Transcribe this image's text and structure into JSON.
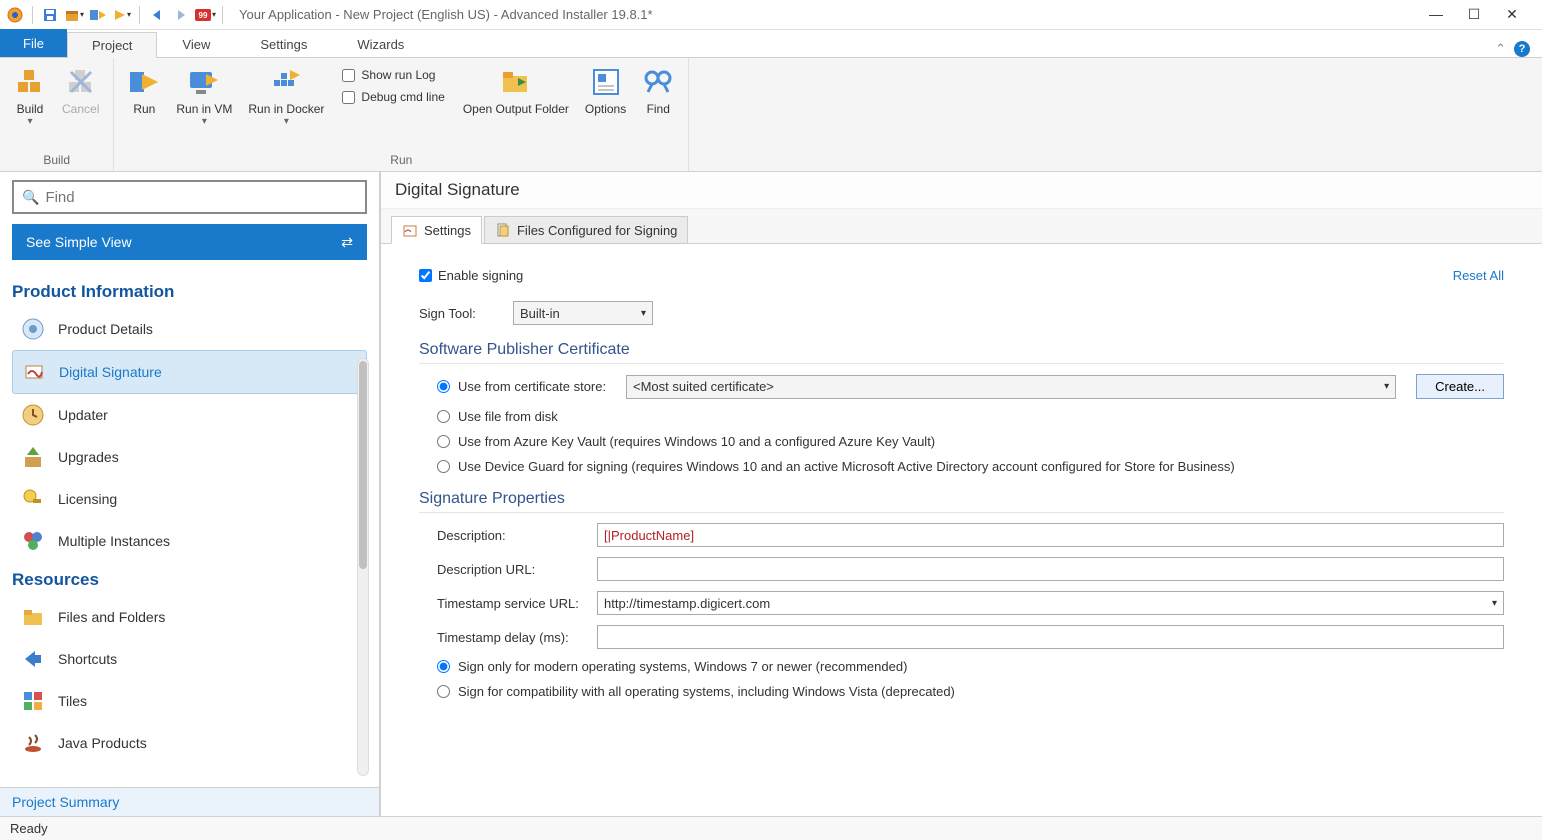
{
  "title": "Your Application - New Project (English US) - Advanced Installer 19.8.1*",
  "tabs": {
    "file": "File",
    "project": "Project",
    "view": "View",
    "settings": "Settings",
    "wizards": "Wizards"
  },
  "ribbon": {
    "build_group": "Build",
    "run_group": "Run",
    "build": "Build",
    "cancel": "Cancel",
    "run": "Run",
    "run_vm": "Run in VM",
    "run_docker": "Run in Docker",
    "show_log": "Show run Log",
    "debug_cmd": "Debug cmd line",
    "open_output": "Open Output Folder",
    "options": "Options",
    "find": "Find"
  },
  "sidebar": {
    "find_placeholder": "Find",
    "simple_view": "See Simple View",
    "sec_product": "Product Information",
    "sec_resources": "Resources",
    "items_product": [
      "Product Details",
      "Digital Signature",
      "Updater",
      "Upgrades",
      "Licensing",
      "Multiple Instances"
    ],
    "items_resources": [
      "Files and Folders",
      "Shortcuts",
      "Tiles",
      "Java Products"
    ],
    "project_summary": "Project Summary"
  },
  "content": {
    "header": "Digital Signature",
    "tab_settings": "Settings",
    "tab_files": "Files Configured for Signing",
    "enable_signing": "Enable signing",
    "reset": "Reset All",
    "sign_tool_label": "Sign Tool:",
    "sign_tool_value": "Built-in",
    "sec_cert": "Software Publisher Certificate",
    "radio_store": "Use from certificate store:",
    "store_value": "<Most suited certificate>",
    "create_btn": "Create...",
    "radio_disk": "Use file from disk",
    "radio_azure": "Use from Azure Key Vault (requires Windows 10 and a configured Azure Key Vault)",
    "radio_devguard": "Use Device Guard for signing (requires Windows 10 and an active Microsoft Active Directory account configured for Store for Business)",
    "sec_sigprops": "Signature Properties",
    "f_desc": "Description:",
    "f_desc_val": "[|ProductName]",
    "f_descurl": "Description URL:",
    "f_descurl_val": "",
    "f_ts": "Timestamp service URL:",
    "f_ts_val": "http://timestamp.digicert.com",
    "f_tsdelay": "Timestamp delay (ms):",
    "f_tsdelay_val": "",
    "radio_modern": "Sign only for modern operating systems, Windows 7 or newer (recommended)",
    "radio_compat": "Sign for compatibility with all operating systems, including Windows Vista (deprecated)"
  },
  "status": "Ready"
}
